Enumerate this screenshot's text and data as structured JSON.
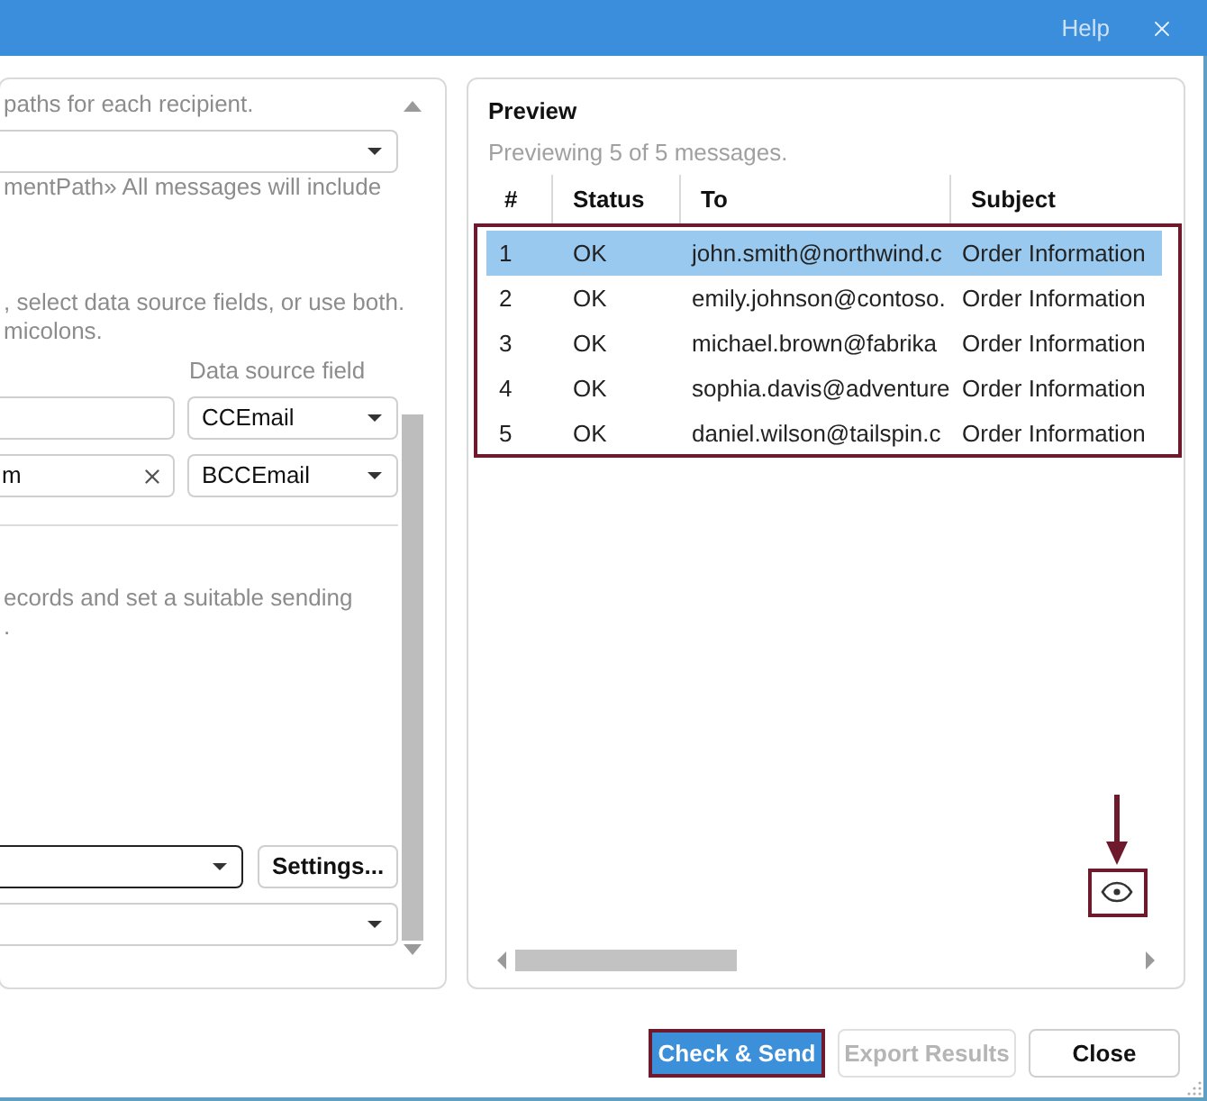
{
  "title_bar": {
    "help": "Help"
  },
  "left_panel": {
    "attachments": {
      "hint": "paths for each recipient.",
      "dropdown": {
        "focused": false
      },
      "note": "mentPath» All messages will include"
    },
    "recipients": {
      "hint_lines": [
        ", select data source fields, or use both.",
        "micolons."
      ],
      "column_label": "Data source field",
      "rows": [
        {
          "field": "CCEmail"
        },
        {
          "value": "m",
          "field": "BCCEmail"
        }
      ]
    },
    "sending": {
      "hint_lines": [
        "ecords and set a suitable sending",
        "."
      ],
      "dropdowns": [
        {
          "focused": true
        },
        {
          "focused": false
        }
      ],
      "settings_button": "Settings..."
    }
  },
  "preview": {
    "title": "Preview",
    "summary": "Previewing 5 of 5 messages.",
    "columns": [
      "#",
      "Status",
      "To",
      "Subject"
    ],
    "rows": [
      {
        "number": "1",
        "status": "OK",
        "to": "john.smith@northwind.c",
        "subject": "Order Information",
        "selected": true
      },
      {
        "number": "2",
        "status": "OK",
        "to": "emily.johnson@contoso.",
        "subject": "Order Information",
        "selected": false
      },
      {
        "number": "3",
        "status": "OK",
        "to": "michael.brown@fabrika",
        "subject": "Order Information",
        "selected": false
      },
      {
        "number": "4",
        "status": "OK",
        "to": "sophia.davis@adventure",
        "subject": "Order Information",
        "selected": false
      },
      {
        "number": "5",
        "status": "OK",
        "to": "daniel.wilson@tailspin.c",
        "subject": "Order Information",
        "selected": false
      }
    ]
  },
  "buttons": [
    {
      "label": "Check & Send",
      "kind": "primary",
      "disabled": false
    },
    {
      "label": "Export Results",
      "kind": "default",
      "disabled": true
    },
    {
      "label": "Close",
      "kind": "default",
      "disabled": false
    }
  ]
}
